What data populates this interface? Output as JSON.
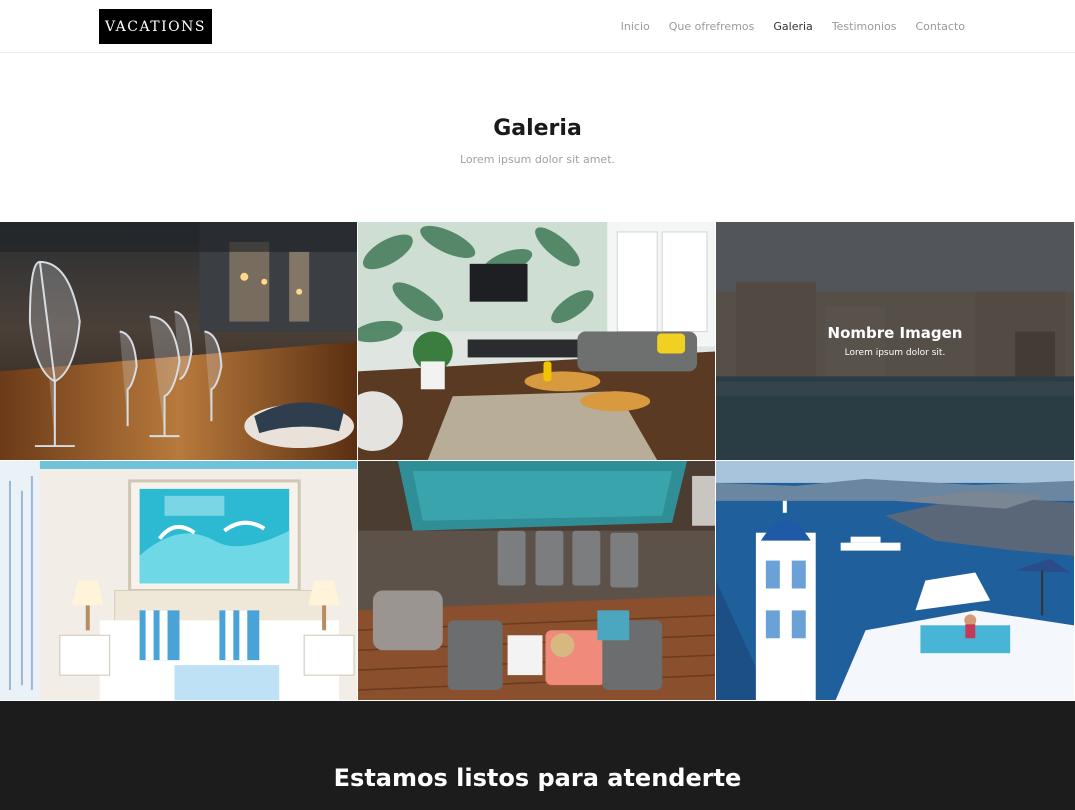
{
  "brand": {
    "logo_text": "VACATIONS"
  },
  "nav": {
    "items": [
      {
        "label": "Inicio"
      },
      {
        "label": "Que ofrefremos"
      },
      {
        "label": "Galeria"
      },
      {
        "label": "Testimonios"
      },
      {
        "label": "Contacto"
      }
    ],
    "active": "Galeria"
  },
  "gallery_section": {
    "title": "Galeria",
    "subtitle": "Lorem ipsum dolor sit amet."
  },
  "gallery": {
    "hover_overlay": {
      "title": "Nombre Imagen",
      "subtitle": "Lorem ipsum dolor sit."
    }
  },
  "cta": {
    "title": "Estamos listos para atenderte"
  },
  "colors": {
    "accent": "#000000",
    "cta_bg": "#1c1c1c",
    "overlay": "#282a2e"
  }
}
